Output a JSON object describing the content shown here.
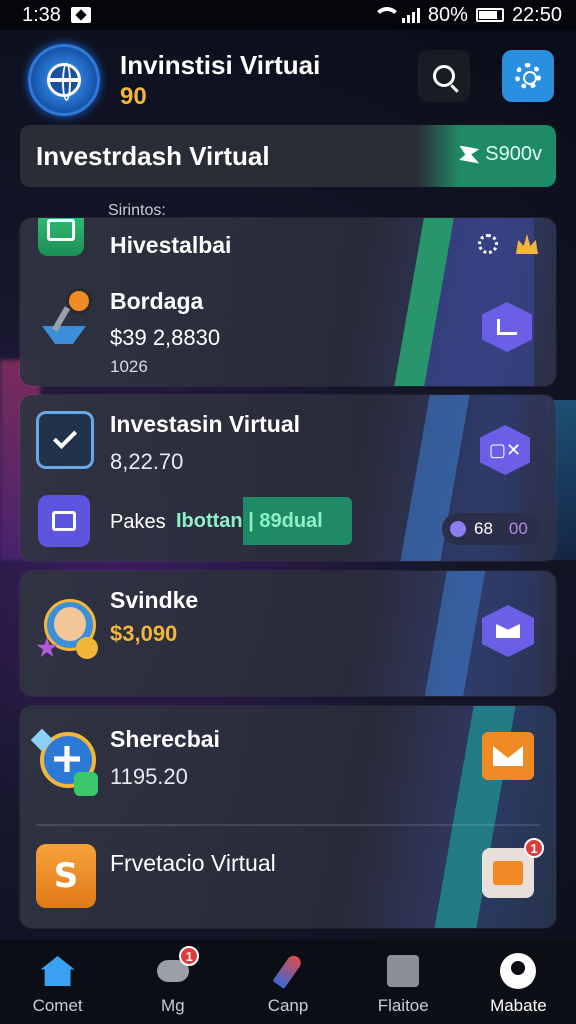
{
  "status_bar": {
    "time": "1:38",
    "battery": "80%",
    "clock": "22:50"
  },
  "header": {
    "title": "Invinstisi Virtuai",
    "subtitle": "90"
  },
  "banner": {
    "title": "Investrdash Virtual",
    "badge": "S900v"
  },
  "section_label": "Sirintos:",
  "cards": [
    {
      "title": "Hivestalbai",
      "subtitle": "Bordaga",
      "value": "$39  2,8830",
      "sub_value": "1026"
    },
    {
      "title": "Investasin Virtual",
      "value": "8,22.70",
      "row_label": "Pakes",
      "tab_text": "Ibottan | 89dual",
      "pill_value": "68",
      "pill_extra": "00"
    },
    {
      "title": "Svindke",
      "value": "$3,090"
    },
    {
      "title": "Sherecbai",
      "value": "1195.20",
      "footer_title": "Frvetacio Virtual",
      "footer_badge": "1"
    }
  ],
  "nav": [
    {
      "label": "Comet",
      "icon": "home-icon"
    },
    {
      "label": "Mg",
      "icon": "gamepad-icon",
      "badge": "1"
    },
    {
      "label": "Canp",
      "icon": "rocket-icon"
    },
    {
      "label": "Flaitoe",
      "icon": "store-icon"
    },
    {
      "label": "Mabate",
      "icon": "profile-icon"
    }
  ],
  "colors": {
    "accent_blue": "#2b8fe0",
    "gold": "#f2b73a",
    "green": "#1f8a66",
    "purple": "#6b5fe8"
  }
}
